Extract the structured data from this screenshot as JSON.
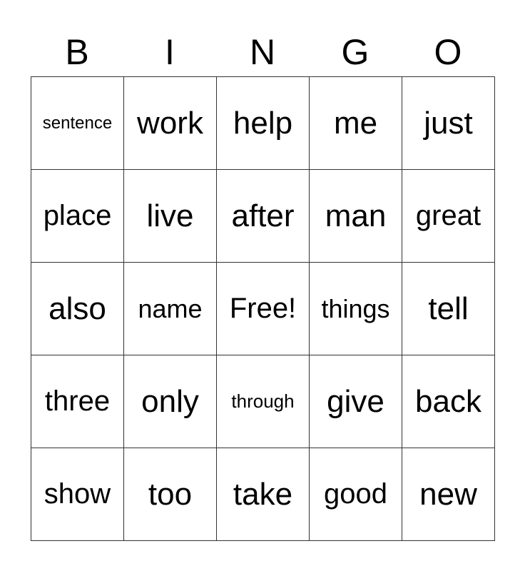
{
  "header": [
    "B",
    "I",
    "N",
    "G",
    "O"
  ],
  "grid": [
    [
      "sentence",
      "work",
      "help",
      "me",
      "just"
    ],
    [
      "place",
      "live",
      "after",
      "man",
      "great"
    ],
    [
      "also",
      "name",
      "Free!",
      "things",
      "tell"
    ],
    [
      "three",
      "only",
      "through",
      "give",
      "back"
    ],
    [
      "show",
      "too",
      "take",
      "good",
      "new"
    ]
  ]
}
